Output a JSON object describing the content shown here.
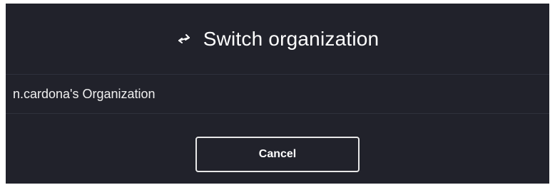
{
  "dialog": {
    "title": "Switch organization",
    "title_icon": "switch-arrows-icon",
    "organizations": [
      {
        "name": "n.cardona's Organization"
      }
    ],
    "cancel_label": "Cancel"
  },
  "colors": {
    "dialog_background": "#21222b",
    "divider": "#2f313c",
    "text": "#ffffff",
    "button_border": "#e8e8e8"
  }
}
